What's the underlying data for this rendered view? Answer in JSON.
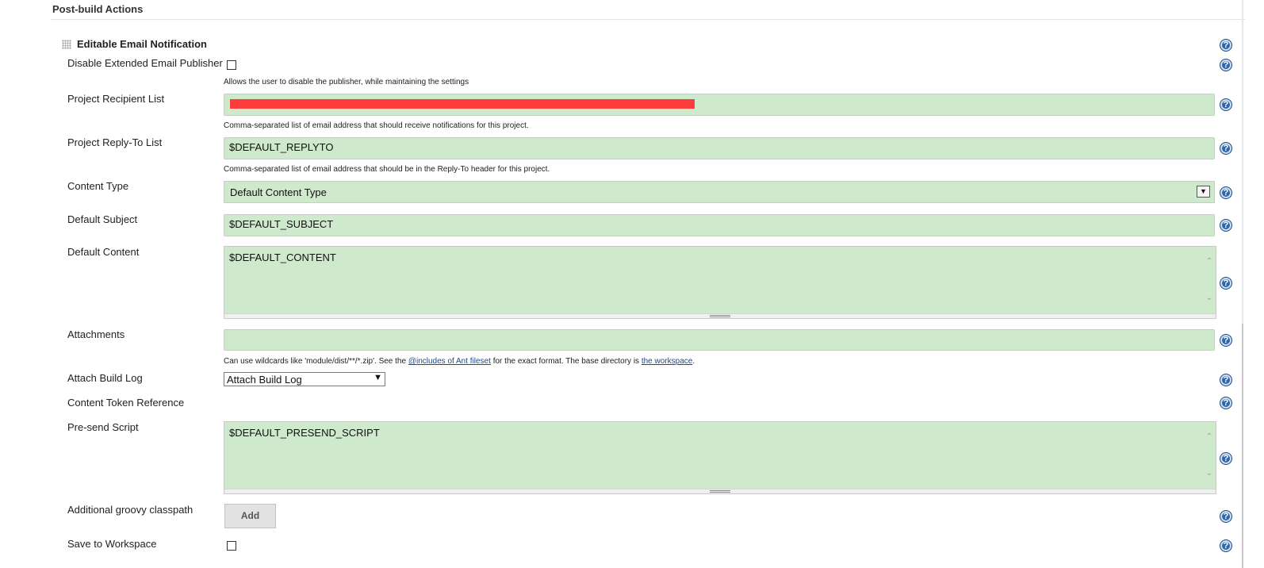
{
  "section": {
    "title": "Post-build Actions"
  },
  "block": {
    "title": "Editable Email Notification"
  },
  "fields": {
    "disable_publisher": {
      "label": "Disable Extended Email Publisher",
      "description": "Allows the user to disable the publisher, while maintaining the settings"
    },
    "recipient_list": {
      "label": "Project Recipient List",
      "description": "Comma-separated list of email address that should receive notifications for this project."
    },
    "reply_to": {
      "label": "Project Reply-To List",
      "value": "$DEFAULT_REPLYTO",
      "description": "Comma-separated list of email address that should be in the Reply-To header for this project."
    },
    "content_type": {
      "label": "Content Type",
      "value": "Default Content Type"
    },
    "default_subject": {
      "label": "Default Subject",
      "value": "$DEFAULT_SUBJECT"
    },
    "default_content": {
      "label": "Default Content",
      "value": "$DEFAULT_CONTENT"
    },
    "attachments": {
      "label": "Attachments",
      "desc_prefix": "Can use wildcards like 'module/dist/**/*.zip'. See the ",
      "desc_link1": "@includes of Ant fileset",
      "desc_mid": " for the exact format. The base directory is ",
      "desc_link2": "the workspace",
      "desc_suffix": "."
    },
    "attach_build_log": {
      "label": "Attach Build Log",
      "value": "Attach Build Log"
    },
    "content_token_reference": {
      "label": "Content Token Reference"
    },
    "presend_script": {
      "label": "Pre-send Script",
      "value": "$DEFAULT_PRESEND_SCRIPT"
    },
    "groovy_classpath": {
      "label": "Additional groovy classpath",
      "button": "Add"
    },
    "save_to_workspace": {
      "label": "Save to Workspace"
    }
  },
  "help_icon": {
    "glyph": "?"
  },
  "colors": {
    "field_bg": "#cfe9cc",
    "help_blue": "#2f66a8",
    "redaction": "#fd3c3c"
  }
}
